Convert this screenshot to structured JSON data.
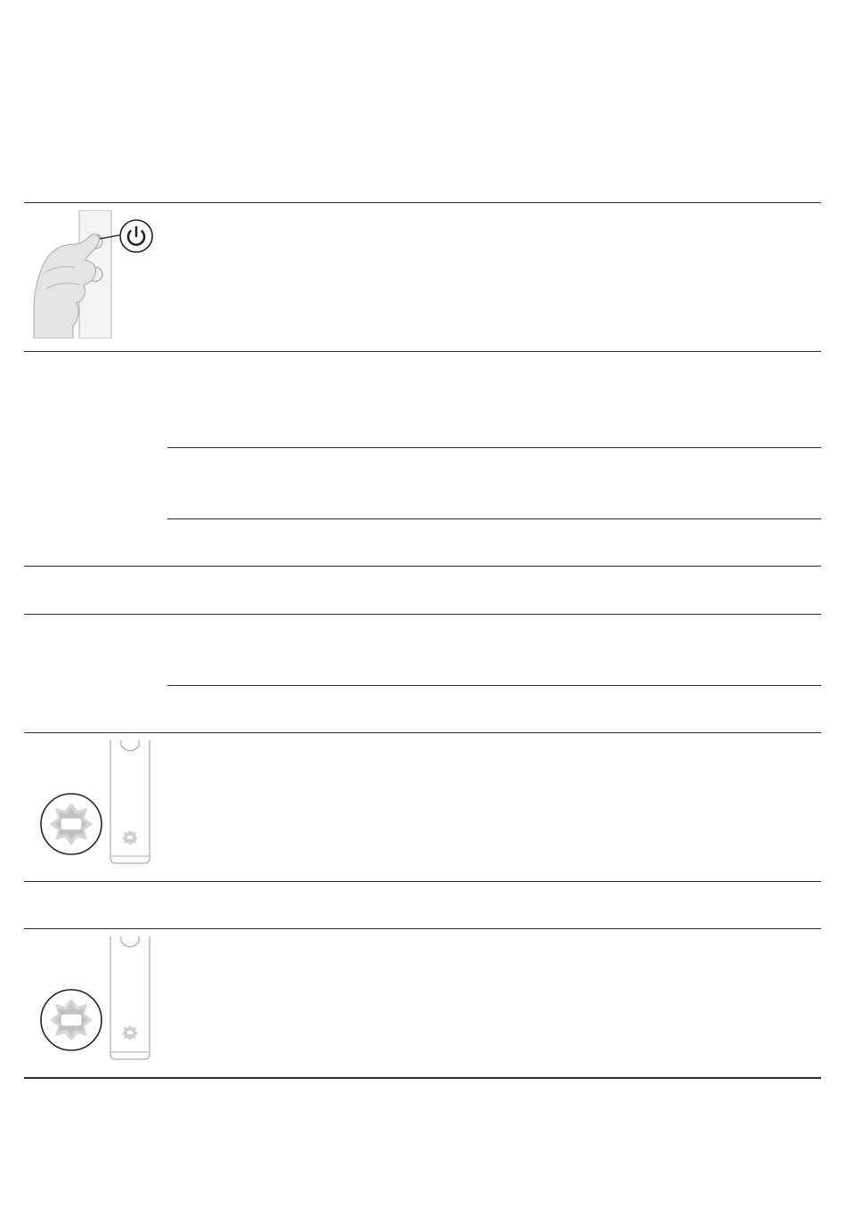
{
  "page": {
    "sections": [
      {
        "id": "power-button-row",
        "illustration": "hand-pressing-power-button",
        "icon": "power-icon"
      },
      {
        "id": "row-2"
      },
      {
        "id": "row-3"
      },
      {
        "id": "row-4"
      },
      {
        "id": "battery-indicator-row-1",
        "illustration": "toothbrush-handle-battery-light",
        "icon": "battery-flashing-icon"
      },
      {
        "id": "row-6"
      },
      {
        "id": "battery-indicator-row-2",
        "illustration": "toothbrush-handle-battery-light",
        "icon": "battery-flashing-icon"
      }
    ]
  },
  "colors": {
    "rule": "#2a2a2a",
    "illustration_fill": "#e8e8e8",
    "illustration_stroke": "#9a9a9a",
    "icon_dark": "#222222"
  }
}
